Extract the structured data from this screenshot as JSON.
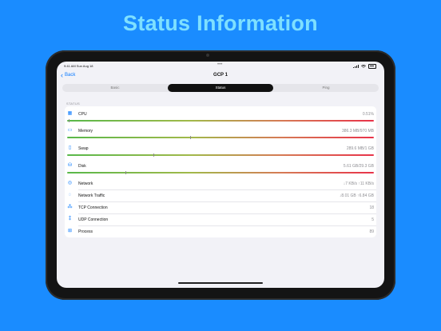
{
  "headline": "Status Information",
  "statusbar": {
    "time": "9:41 AM  Sun Aug 18",
    "dots": "•••"
  },
  "nav": {
    "back_label": "Back",
    "title": "GCP 1"
  },
  "tabs": [
    {
      "label": "Basic",
      "active": false
    },
    {
      "label": "Status",
      "active": true
    },
    {
      "label": "Ping",
      "active": false
    }
  ],
  "section": "STATUS",
  "rows": [
    {
      "key": "cpu",
      "icon": "cpu-icon",
      "label": "CPU",
      "value": "0.51%",
      "bar": 0.0051
    },
    {
      "key": "memory",
      "icon": "memory-icon",
      "label": "Memory",
      "value": "386.3 MB/970 MB",
      "bar": 0.4
    },
    {
      "key": "swap",
      "icon": "swap-file-icon",
      "label": "Swap",
      "value": "289.6 MB/1 GB",
      "bar": 0.28
    },
    {
      "key": "disk",
      "icon": "disk-icon",
      "label": "Disk",
      "value": "5.61 GB/29.3 GB",
      "bar": 0.19
    },
    {
      "key": "network",
      "icon": "network-icon",
      "label": "Network",
      "value": "↓7 KB/s ↑11 KB/s"
    },
    {
      "key": "traffic",
      "icon": "traffic-icon",
      "label": "Network Traffic",
      "value": "↓8.01 GB ↑6.84 GB"
    },
    {
      "key": "tcp",
      "icon": "tcp-icon",
      "label": "TCP Connection",
      "value": "18"
    },
    {
      "key": "udp",
      "icon": "udp-icon",
      "label": "UDP Connection",
      "value": "5"
    },
    {
      "key": "process",
      "icon": "process-icon",
      "label": "Process",
      "value": "89"
    }
  ]
}
